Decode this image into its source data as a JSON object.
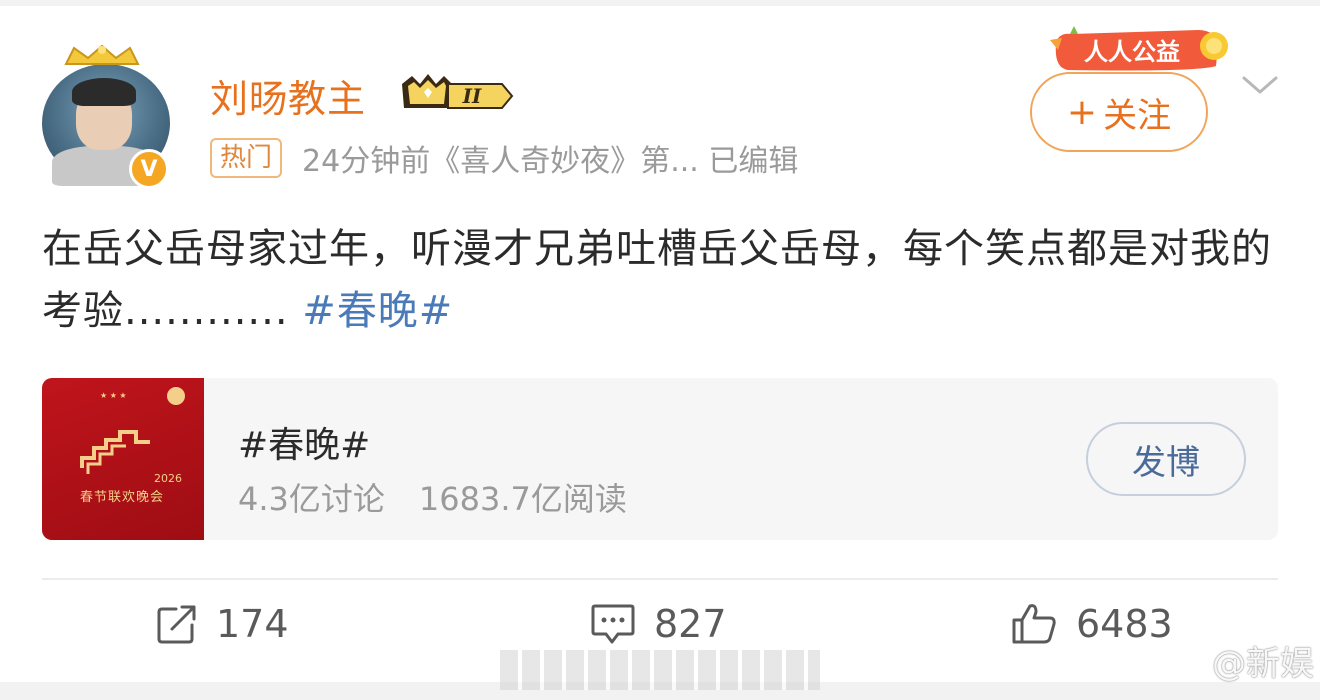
{
  "post": {
    "username": "刘旸教主",
    "vip_level": "II",
    "hot_tag": "热门",
    "meta_text": "24分钟前《喜人奇妙夜》第... 已编辑",
    "verified_badge": "V",
    "charity_badge": "人人公益",
    "follow_label": "关注",
    "follow_plus": "+",
    "text_before_tag": "在岳父岳母家过年，听漫才兄弟吐槽岳父岳母，每个笑点都是对我的考验............",
    "hashtag": "#春晚#"
  },
  "topic_card": {
    "title": "#春晚#",
    "discussions": "4.3亿讨论",
    "reads": "1683.7亿阅读",
    "post_button": "发博",
    "thumb_caption": "春节联欢晚会"
  },
  "actions": {
    "repost_count": "174",
    "comment_count": "827",
    "like_count": "6483"
  },
  "watermark": "@新娱",
  "colors": {
    "username": "#e8711e",
    "hashtag": "#4a7ab8",
    "follow_border": "#f1a45b",
    "thumb_red": "#c0141c"
  },
  "icons": [
    "crown-icon",
    "chevron-down-icon",
    "repost-icon",
    "comment-icon",
    "like-icon",
    "weibo-logo-icon"
  ]
}
